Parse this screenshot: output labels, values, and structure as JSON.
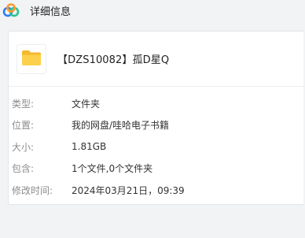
{
  "window": {
    "title": "详细信息",
    "logo_icon": "cloud-logo-icon"
  },
  "file": {
    "icon": "folder-icon",
    "name": "【DZS10082】孤D星Q"
  },
  "details": [
    {
      "label": "类型:",
      "value": "文件夹"
    },
    {
      "label": "位置:",
      "value": "我的网盘/哇哈电子书籍"
    },
    {
      "label": "大小:",
      "value": "1.81GB"
    },
    {
      "label": "包含:",
      "value": "1个文件,0个文件夹"
    },
    {
      "label": "修改时间:",
      "value": "2024年03月21日，09:39"
    }
  ],
  "colors": {
    "background": "#f1f3f5",
    "panel": "#ffffff",
    "folder": "#f8c93f",
    "logo_blue": "#2f7df6",
    "logo_orange": "#ff9a2e",
    "logo_green": "#2dc58f"
  }
}
